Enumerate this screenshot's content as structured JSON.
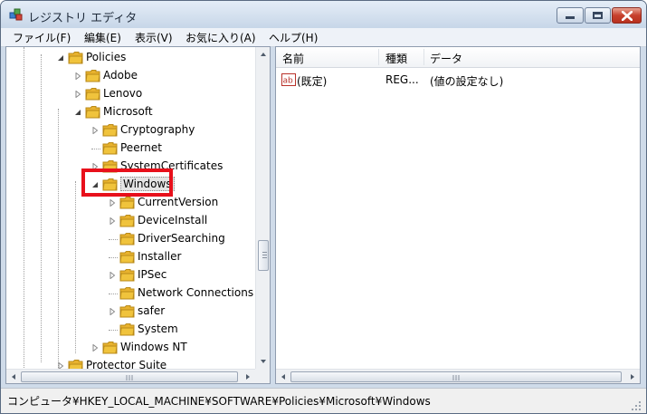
{
  "window": {
    "title": "レジストリ エディタ",
    "icon": "regedit-icon",
    "controls": [
      "minimize-icon",
      "maximize-icon",
      "close-icon"
    ],
    "close_color": "#c7402d"
  },
  "menu": [
    {
      "label": "ファイル(F)"
    },
    {
      "label": "編集(E)"
    },
    {
      "label": "表示(V)"
    },
    {
      "label": "お気に入り(A)"
    },
    {
      "label": "ヘルプ(H)"
    }
  ],
  "tree": {
    "nodes": [
      {
        "label": "Policies",
        "level": 0,
        "expander": "expanded"
      },
      {
        "label": "Adobe",
        "level": 1,
        "expander": "collapsed"
      },
      {
        "label": "Lenovo",
        "level": 1,
        "expander": "collapsed"
      },
      {
        "label": "Microsoft",
        "level": 1,
        "expander": "expanded"
      },
      {
        "label": "Cryptography",
        "level": 2,
        "expander": "collapsed"
      },
      {
        "label": "Peernet",
        "level": 2,
        "expander": "none"
      },
      {
        "label": "SystemCertificates",
        "level": 2,
        "expander": "collapsed"
      },
      {
        "label": "Windows",
        "level": 2,
        "expander": "expanded",
        "selected": true
      },
      {
        "label": "CurrentVersion",
        "level": 3,
        "expander": "collapsed"
      },
      {
        "label": "DeviceInstall",
        "level": 3,
        "expander": "collapsed"
      },
      {
        "label": "DriverSearching",
        "level": 3,
        "expander": "none"
      },
      {
        "label": "Installer",
        "level": 3,
        "expander": "none"
      },
      {
        "label": "IPSec",
        "level": 3,
        "expander": "collapsed"
      },
      {
        "label": "Network Connections",
        "level": 3,
        "expander": "none"
      },
      {
        "label": "safer",
        "level": 3,
        "expander": "collapsed"
      },
      {
        "label": "System",
        "level": 3,
        "expander": "none"
      },
      {
        "label": "Windows NT",
        "level": 2,
        "expander": "collapsed"
      },
      {
        "label": "Protector Suite",
        "level": 0,
        "expander": "collapsed"
      }
    ],
    "folder_color": "#f0c33c",
    "scroll_position": 0.68
  },
  "list": {
    "columns": [
      "名前",
      "種類",
      "データ"
    ],
    "rows": [
      {
        "name": "(既定)",
        "type": "REG...",
        "data": "(値の設定なし)",
        "icon": "string-value-icon"
      }
    ]
  },
  "status": {
    "path": "コンピュータ¥HKEY_LOCAL_MACHINE¥SOFTWARE¥Policies¥Microsoft¥Windows"
  },
  "annotation": {
    "target": "Windows",
    "color": "#e8101b"
  }
}
